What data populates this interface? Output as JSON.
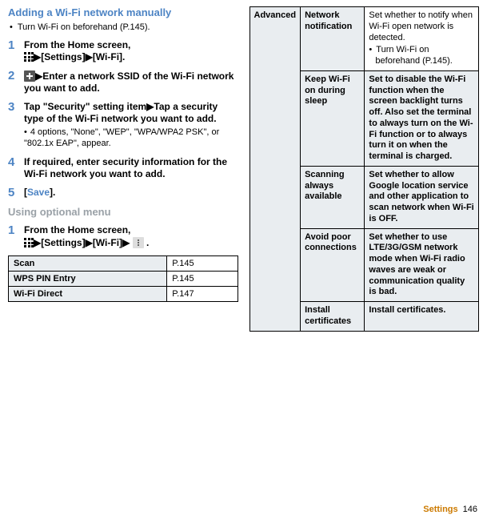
{
  "left": {
    "heading1": "Adding a Wi-Fi network manually",
    "preBullet": "Turn Wi-Fi on beforehand (P.145).",
    "steps": [
      {
        "num": "1",
        "body_pre": "From the Home screen, ",
        "body_post": "[Settings]",
        "tail": "[Wi-Fi]."
      },
      {
        "num": "2",
        "body": "Enter a network SSID of the Wi-Fi network you want to add."
      },
      {
        "num": "3",
        "body": "Tap \"Security\" setting item▶Tap a security type of the Wi-Fi network you want to add.",
        "sub": "4 options, \"None\", \"WEP\", \"WPA/WPA2 PSK\", or \"802.1x EAP\", appear."
      },
      {
        "num": "4",
        "body": "If required, enter security information for the Wi-Fi network you want to add."
      },
      {
        "num": "5",
        "body_save": "[Save]."
      }
    ],
    "heading2": "Using optional menu",
    "step2": {
      "num": "1",
      "body_pre": "From the Home screen, ",
      "body_mid": "[Settings]",
      "body_mid2": "[Wi-Fi]"
    },
    "optTable": [
      {
        "name": "Scan",
        "page": "P.145"
      },
      {
        "name": "WPS PIN Entry",
        "page": "P.145"
      },
      {
        "name": "Wi-Fi Direct",
        "page": "P.147"
      }
    ]
  },
  "right": {
    "groupLabel": "Advanced",
    "rows": [
      {
        "label": "Network notification",
        "desc": "Set whether to notify when Wi-Fi open network is detected.",
        "bullet": "Turn Wi-Fi on beforehand (P.145)."
      },
      {
        "label": "Keep Wi-Fi on during sleep",
        "desc": "Set to disable the Wi-Fi function when the screen backlight turns off. Also set the terminal to always turn on the Wi-Fi function or to always turn it on when the terminal is charged."
      },
      {
        "label": "Scanning always available",
        "desc": "Set whether to allow Google location service and other application to scan network when Wi-Fi is OFF."
      },
      {
        "label": "Avoid poor connections",
        "desc": "Set whether to use LTE/3G/GSM network mode when Wi-Fi radio waves are weak or communication quality is bad."
      },
      {
        "label": "Install certificates",
        "desc": "Install certificates."
      }
    ]
  },
  "footer": {
    "section": "Settings",
    "page": "146"
  }
}
